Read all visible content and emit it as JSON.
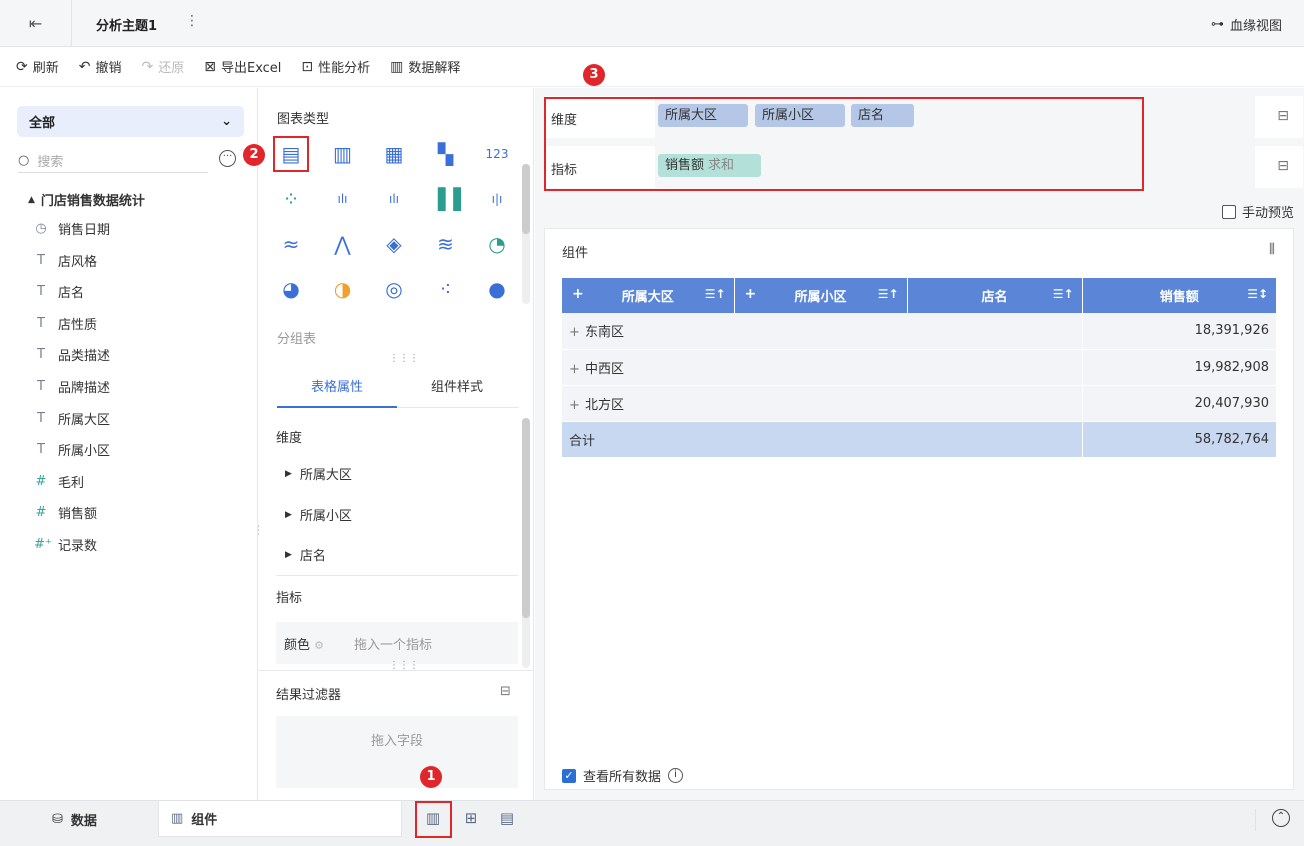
{
  "header": {
    "title": "分析主题1",
    "lineage_label": "血缘视图"
  },
  "toolbar": {
    "refresh": "刷新",
    "undo": "撤销",
    "redo": "还原",
    "export": "导出Excel",
    "perf": "性能分析",
    "explain": "数据解释"
  },
  "left": {
    "select_value": "全部",
    "search_placeholder": "搜索",
    "tree_root": "门店销售数据统计",
    "fields": [
      {
        "label": "销售日期",
        "type": "date-icon"
      },
      {
        "label": "店风格",
        "type": "text-icon"
      },
      {
        "label": "店名",
        "type": "text-icon"
      },
      {
        "label": "店性质",
        "type": "text-icon"
      },
      {
        "label": "品类描述",
        "type": "text-icon"
      },
      {
        "label": "品牌描述",
        "type": "text-icon"
      },
      {
        "label": "所属大区",
        "type": "text-icon"
      },
      {
        "label": "所属小区",
        "type": "text-icon"
      },
      {
        "label": "毛利",
        "type": "number-icon"
      },
      {
        "label": "销售额",
        "type": "number-icon"
      },
      {
        "label": "记录数",
        "type": "count-icon"
      }
    ]
  },
  "middle": {
    "chart_type_title": "图表类型",
    "group_label": "分组表",
    "tabs": [
      "表格属性",
      "组件样式"
    ],
    "dimension_label": "维度",
    "dimension_items": [
      "所属大区",
      "所属小区",
      "店名"
    ],
    "measure_label": "指标",
    "color_label": "颜色",
    "color_placeholder": "拖入一个指标",
    "filter_title": "结果过滤器",
    "filter_placeholder": "拖入字段"
  },
  "right": {
    "dimension_label": "维度",
    "dimensions": [
      "所属大区",
      "所属小区",
      "店名"
    ],
    "measure_label": "指标",
    "measure_pill": "销售额",
    "measure_agg": "求和",
    "manual_preview": "手动预览",
    "panel_title": "组件",
    "view_all": "查看所有数据",
    "table": {
      "headers": [
        "所属大区",
        "所属小区",
        "店名",
        "销售额"
      ],
      "rows": [
        {
          "region": "东南区",
          "value": "18,391,926"
        },
        {
          "region": "中西区",
          "value": "19,982,908"
        },
        {
          "region": "北方区",
          "value": "20,407,930"
        }
      ],
      "total_label": "合计",
      "total_value": "58,782,764"
    }
  },
  "bottom": {
    "data_tab": "数据",
    "component_tab": "组件"
  },
  "badges": [
    "1",
    "2",
    "3"
  ],
  "colors": {
    "accent": "#3b6fd8",
    "header_blue": "#5b86d8",
    "highlight_red": "#e0262b"
  }
}
